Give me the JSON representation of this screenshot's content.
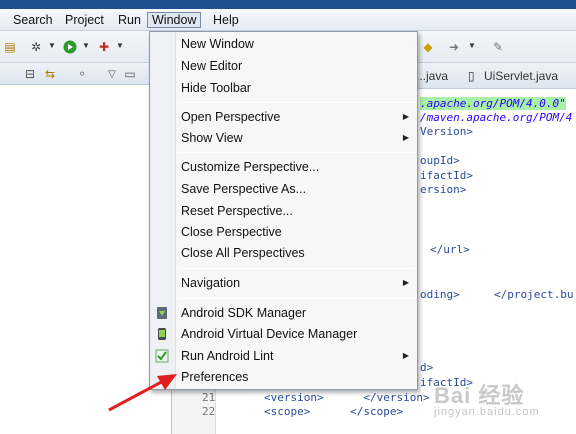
{
  "menubar": {
    "items": [
      "Search",
      "Project",
      "Run",
      "Window",
      "Help"
    ],
    "active": "Window"
  },
  "editor": {
    "tabs": [
      "...java",
      "UiServlet.java"
    ],
    "lines": [
      {
        "text": ".apache.org/POM/4.0.0\"",
        "style": "hl"
      },
      {
        "text": "/maven.apache.org/POM/4",
        "style": "str"
      },
      {
        "text": "Version>",
        "style": "tag"
      },
      {
        "text": "oupId>",
        "style": "tag"
      },
      {
        "text": "ifactId>",
        "style": "tag"
      },
      {
        "text": "ersion>",
        "style": "tag"
      },
      {
        "text": "</url>",
        "style": "tag"
      },
      {
        "text": "oding>",
        "style": "tag"
      },
      {
        "text": "</project.bu",
        "style": "tag"
      },
      {
        "text": "d>",
        "style": "tag"
      },
      {
        "text": "ifactId>",
        "style": "tag"
      }
    ],
    "line_numbers": [
      "21",
      "22"
    ],
    "line21": "<version>      </version>",
    "line22": "<scope>      </scope>"
  },
  "window_menu": {
    "groups": [
      [
        {
          "label": "New Window"
        },
        {
          "label": "New Editor"
        },
        {
          "label": "Hide Toolbar"
        }
      ],
      [
        {
          "label": "Open Perspective",
          "submenu": true
        },
        {
          "label": "Show View",
          "submenu": true
        }
      ],
      [
        {
          "label": "Customize Perspective..."
        },
        {
          "label": "Save Perspective As..."
        },
        {
          "label": "Reset Perspective..."
        },
        {
          "label": "Close Perspective"
        },
        {
          "label": "Close All Perspectives"
        }
      ],
      [
        {
          "label": "Navigation",
          "submenu": true
        }
      ],
      [
        {
          "label": "Android SDK Manager",
          "icon": "android-sdk-icon"
        },
        {
          "label": "Android Virtual Device Manager",
          "icon": "android-device-icon"
        },
        {
          "label": "Run Android Lint",
          "icon": "lint-check-icon",
          "submenu": true
        },
        {
          "label": "Preferences"
        }
      ]
    ]
  },
  "watermark": {
    "text": "Bai 经验",
    "sub": "jingyan.baidu.com"
  },
  "colors": {
    "title_bar": "#1f4f8f",
    "annotation_arrow": "#e02020",
    "highlight": "#a8f0a8"
  }
}
